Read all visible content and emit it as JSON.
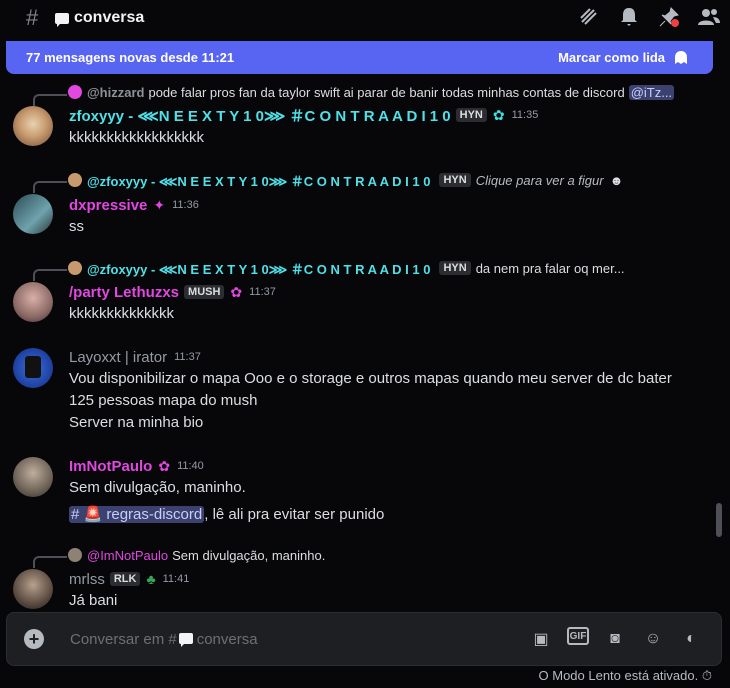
{
  "header": {
    "hash": "#",
    "channel": "conversa",
    "icons": [
      "threads-icon",
      "bell-icon",
      "pin-icon",
      "members-icon"
    ]
  },
  "banner": {
    "text": "77 mensagens novas desde 11:21",
    "mark": "Marcar como lida"
  },
  "messages": [
    {
      "reply": {
        "name": "@hizzard",
        "text": "pode falar pros fan da taylor swift ai parar de banir todas minhas contas de discord",
        "mention": "@iTz..."
      },
      "name": "zfoxyyy - ⋘N E E X T Y 1 0⋙ ＃C O N T R A A D I 1 0",
      "tag": "HYN",
      "time": "11:35",
      "lines": [
        "kkkkkkkkkkkkkkkkkk"
      ]
    },
    {
      "reply": {
        "name": "@zfoxyyy - ⋘N E E X T Y 1 0⋙ ＃C O N T R A A D I 1 0",
        "tag": "HYN",
        "text": "Clique para ver a figur"
      },
      "name": "dxpressive",
      "time": "11:36",
      "lines": [
        "ss"
      ]
    },
    {
      "reply": {
        "name": "@zfoxyyy - ⋘N E E X T Y 1 0⋙ ＃C O N T R A A D I 1 0",
        "tag": "HYN",
        "text": "da nem pra falar oq mer..."
      },
      "name": "/party Lethuzxs",
      "tag": "MUSH",
      "time": "11:37",
      "lines": [
        "kkkkkkkkkkkkkk"
      ]
    },
    {
      "name": "Layoxxt | irator",
      "time": "11:37",
      "lines": [
        "Vou disponibilizar o mapa Ooo e o storage e outros mapas quando meu server de dc bater",
        "125 pessoas mapa do mush",
        "Server na minha bio"
      ]
    },
    {
      "name": "ImNotPaulo",
      "time": "11:40",
      "lines": [
        "Sem divulgação, maninho."
      ],
      "channel_mention": "regras-discord",
      "after_mention": ", lê ali pra evitar ser punido"
    },
    {
      "reply": {
        "name": "@ImNotPaulo",
        "text": "Sem divulgação, maninho."
      },
      "name": "mrlss",
      "tag": "RLK",
      "time": "11:41",
      "lines": [
        "Já bani"
      ]
    }
  ],
  "composer": {
    "placeholder": "Conversar em #",
    "channel": "conversa"
  },
  "slowmode": "O Modo Lento está ativado."
}
